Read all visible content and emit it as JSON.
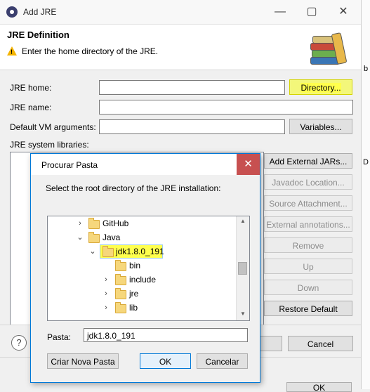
{
  "main_window": {
    "title": "Add JRE",
    "controls": {
      "minimize": "—",
      "maximize": "▢",
      "close": "✕"
    },
    "header_title": "JRE Definition",
    "header_message": "Enter the home directory of the JRE.",
    "labels": {
      "jre_home": "JRE home:",
      "jre_name": "JRE name:",
      "vm_args": "Default VM arguments:",
      "system_libraries": "JRE system libraries:"
    },
    "values": {
      "jre_home": "",
      "jre_name": "",
      "vm_args": ""
    },
    "buttons": {
      "directory": "Directory...",
      "variables": "Variables...",
      "add_external_jars": "Add External JARs...",
      "javadoc_location": "Javadoc Location...",
      "source_attachment": "Source Attachment...",
      "external_annotations": "External annotations...",
      "remove": "Remove",
      "up": "Up",
      "down": "Down",
      "restore_default": "Restore Default",
      "cancel": "Cancel",
      "help": "?",
      "partial_ok": "OK"
    },
    "side_chars": {
      "b": "b",
      "d": "D"
    }
  },
  "browse_dialog": {
    "title": "Procurar Pasta",
    "close": "✕",
    "instruction": "Select the root directory of the JRE installation:",
    "tree": [
      {
        "label": "GitHub",
        "expanded": false,
        "selected": false
      },
      {
        "label": "Java",
        "expanded": true,
        "selected": false
      },
      {
        "label": "jdk1.8.0_191",
        "expanded": true,
        "selected": true
      },
      {
        "label": "bin",
        "expanded": false,
        "selected": false
      },
      {
        "label": "include",
        "expanded": false,
        "selected": false
      },
      {
        "label": "jre",
        "expanded": false,
        "selected": false
      },
      {
        "label": "lib",
        "expanded": false,
        "selected": false
      }
    ],
    "folder_label": "Pasta:",
    "folder_value": "jdk1.8.0_191",
    "buttons": {
      "new_folder": "Criar Nova Pasta",
      "ok": "OK",
      "cancel": "Cancelar"
    }
  },
  "colors": {
    "highlight": "#ffff4d",
    "dialog_border": "#0078d7",
    "close_red": "#c75050"
  }
}
